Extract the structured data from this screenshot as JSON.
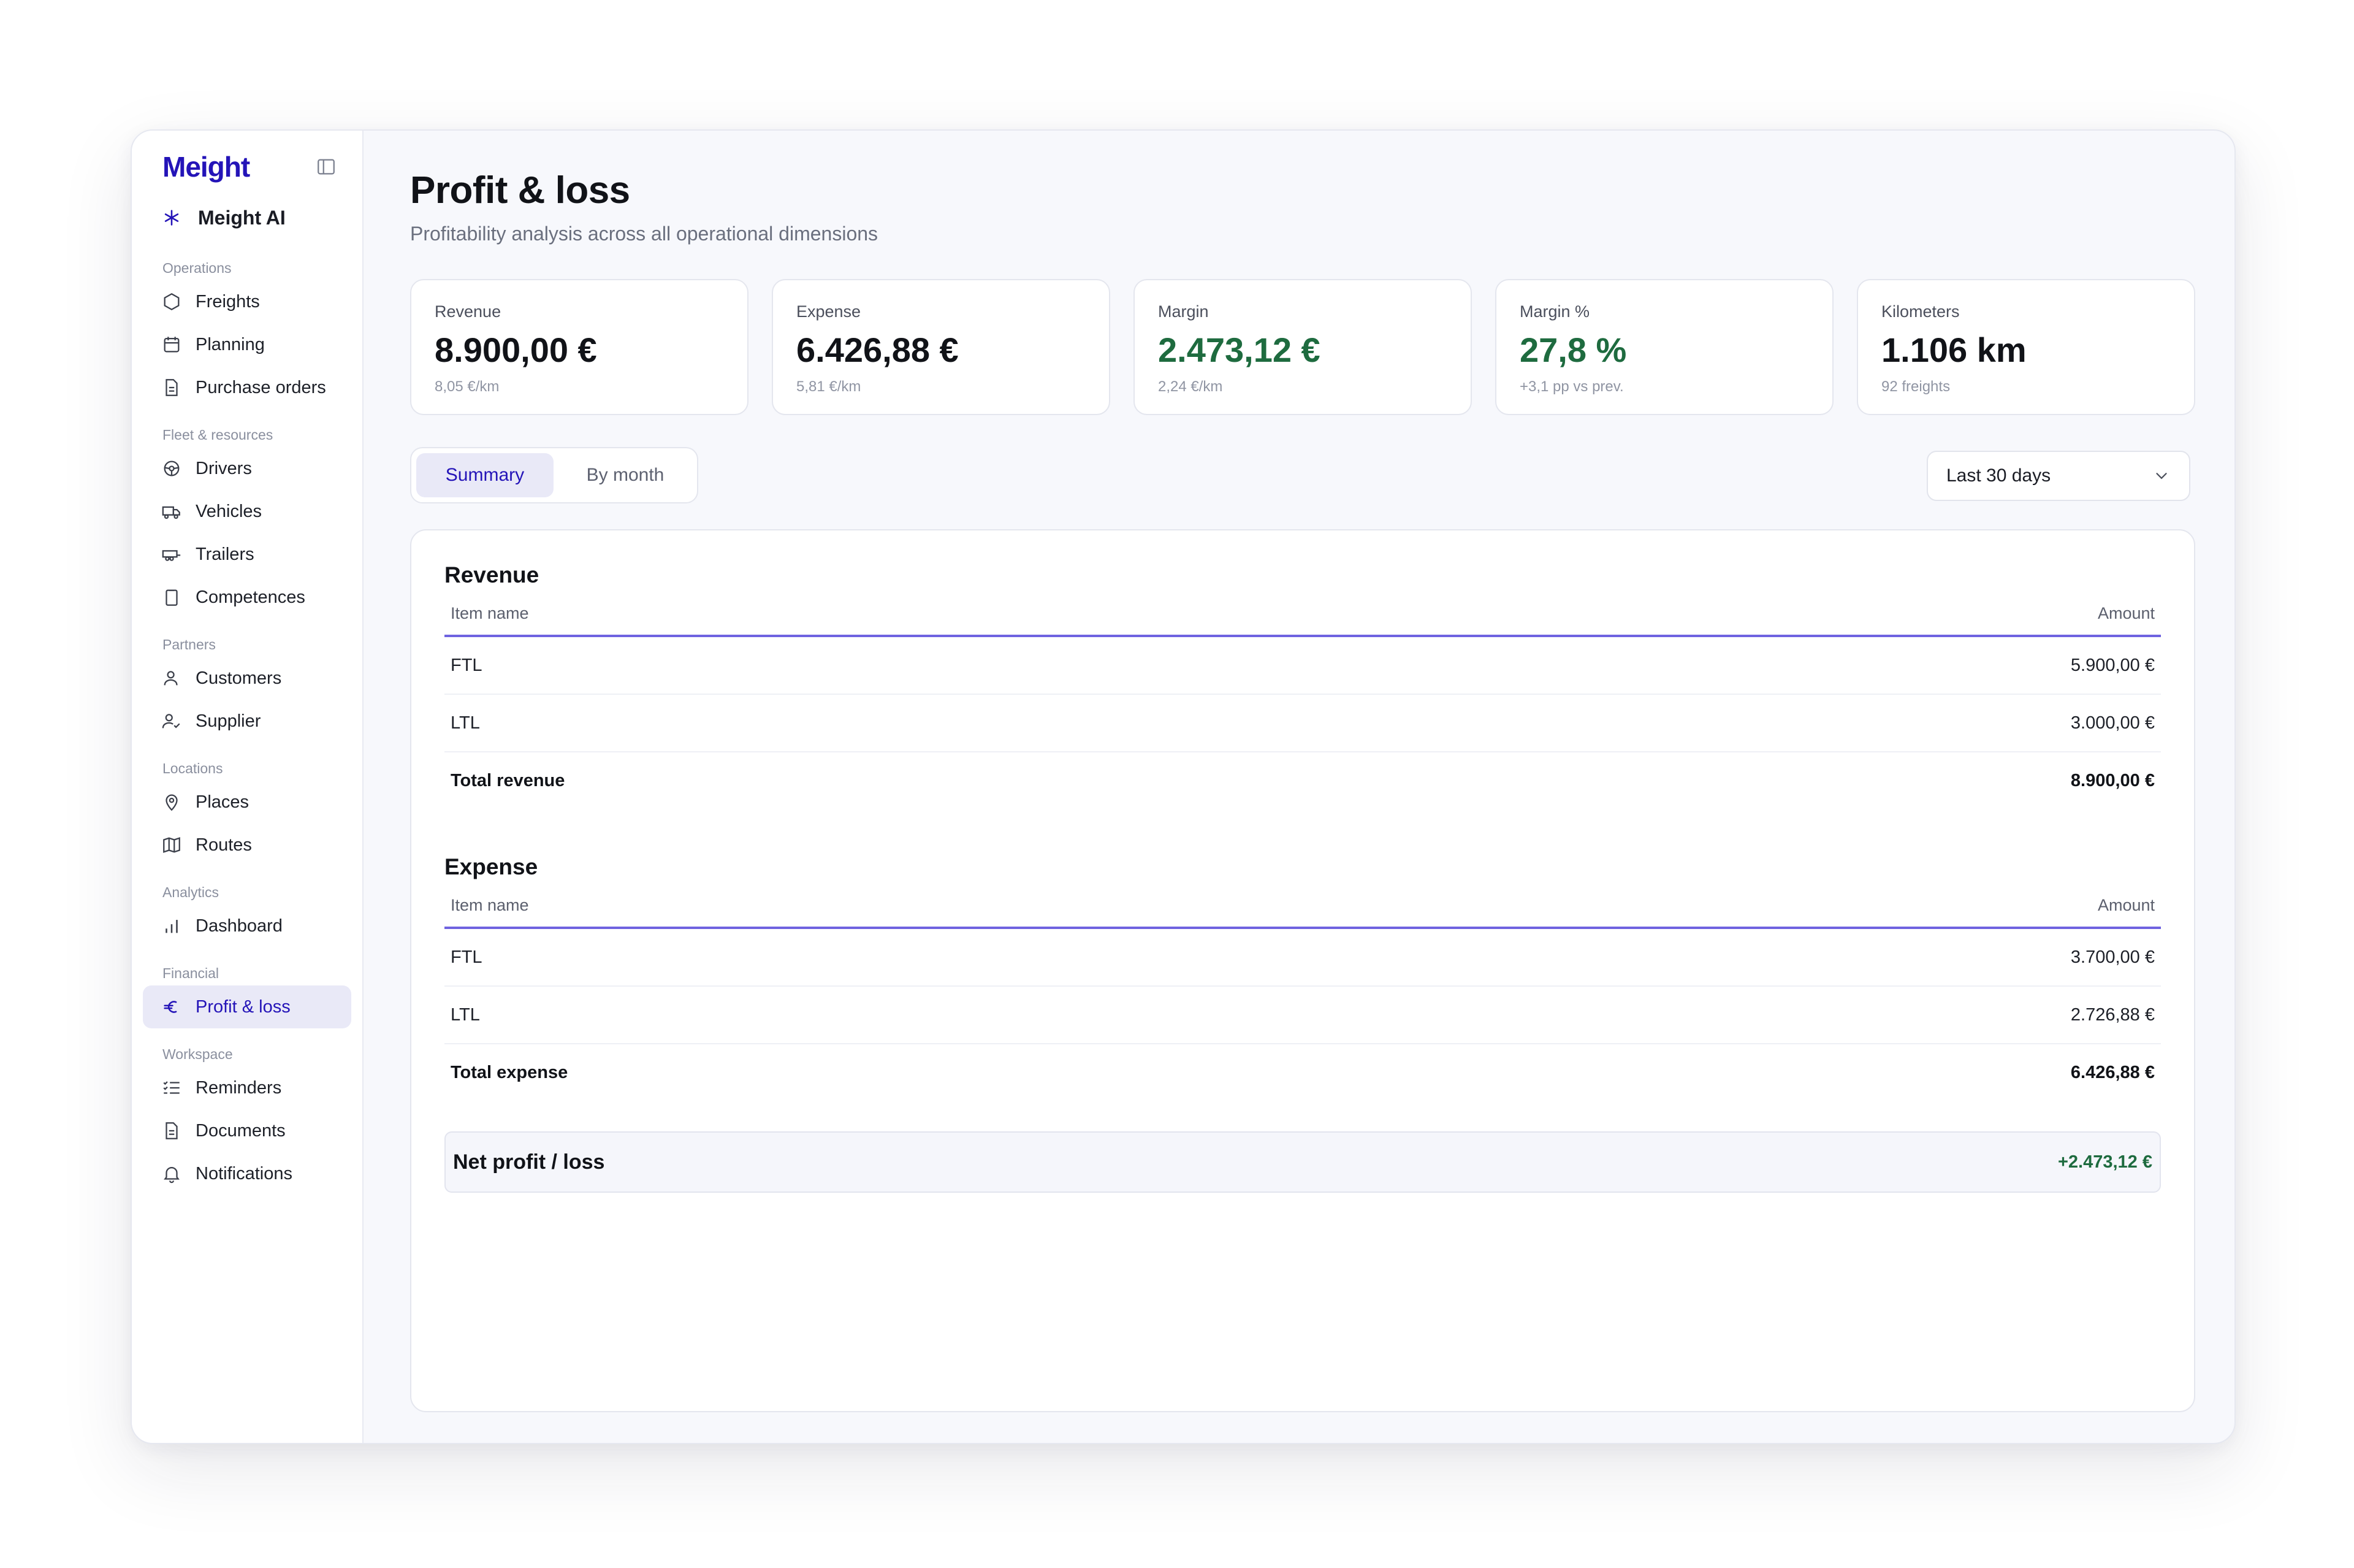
{
  "app": {
    "brand": "Meight",
    "ai_label": "Meight AI"
  },
  "sidebar": {
    "sections": [
      {
        "label": "Operations",
        "items": [
          {
            "label": "Freights",
            "icon": "hexagon-icon"
          },
          {
            "label": "Planning",
            "icon": "calendar-icon"
          },
          {
            "label": "Purchase orders",
            "icon": "document-icon"
          }
        ]
      },
      {
        "label": "Fleet & resources",
        "items": [
          {
            "label": "Drivers",
            "icon": "steering-wheel-icon"
          },
          {
            "label": "Vehicles",
            "icon": "truck-icon"
          },
          {
            "label": "Trailers",
            "icon": "trailer-icon"
          },
          {
            "label": "Competences",
            "icon": "clipboard-icon"
          }
        ]
      },
      {
        "label": "Partners",
        "items": [
          {
            "label": "Customers",
            "icon": "user-icon"
          },
          {
            "label": "Supplier",
            "icon": "user-check-icon"
          }
        ]
      },
      {
        "label": "Locations",
        "items": [
          {
            "label": "Places",
            "icon": "map-pin-icon"
          },
          {
            "label": "Routes",
            "icon": "map-icon"
          }
        ]
      },
      {
        "label": "Analytics",
        "items": [
          {
            "label": "Dashboard",
            "icon": "bar-chart-icon"
          }
        ]
      },
      {
        "label": "Financial",
        "items": [
          {
            "label": "Profit & loss",
            "icon": "euro-icon",
            "active": true
          }
        ]
      },
      {
        "label": "Workspace",
        "items": [
          {
            "label": "Reminders",
            "icon": "list-check-icon"
          },
          {
            "label": "Documents",
            "icon": "document-icon"
          },
          {
            "label": "Notifications",
            "icon": "bell-icon"
          }
        ]
      }
    ]
  },
  "header": {
    "title": "Profit & loss",
    "subtitle": "Profitability analysis across all operational dimensions"
  },
  "kpis": [
    {
      "label": "Revenue",
      "value": "8.900,00 €",
      "sub": "8,05 €/km",
      "positive": false
    },
    {
      "label": "Expense",
      "value": "6.426,88 €",
      "sub": "5,81 €/km",
      "positive": false
    },
    {
      "label": "Margin",
      "value": "2.473,12 €",
      "sub": "2,24 €/km",
      "positive": true
    },
    {
      "label": "Margin %",
      "value": "27,8 %",
      "sub": "+3,1 pp vs prev.",
      "positive": true
    },
    {
      "label": "Kilometers",
      "value": "1.106 km",
      "sub": "92 freights",
      "positive": false
    }
  ],
  "tabs": {
    "summary": "Summary",
    "by_month": "By month",
    "active": "summary"
  },
  "range": {
    "selected": "Last 30 days"
  },
  "revenue": {
    "title": "Revenue",
    "col_item": "Item name",
    "col_amount": "Amount",
    "rows": [
      {
        "name": "FTL",
        "amount": "5.900,00 €"
      },
      {
        "name": "LTL",
        "amount": "3.000,00 €"
      }
    ],
    "total_label": "Total revenue",
    "total_amount": "8.900,00 €"
  },
  "expense": {
    "title": "Expense",
    "col_item": "Item name",
    "col_amount": "Amount",
    "rows": [
      {
        "name": "FTL",
        "amount": "3.700,00 €"
      },
      {
        "name": "LTL",
        "amount": "2.726,88 €"
      }
    ],
    "total_label": "Total expense",
    "total_amount": "6.426,88 €"
  },
  "net": {
    "label": "Net profit / loss",
    "value": "+2.473,12 €"
  },
  "colors": {
    "brand": "#2414b8",
    "positive": "#1e6b3f",
    "accent_line": "#6f63e0",
    "active_bg": "#e9e9f7"
  }
}
